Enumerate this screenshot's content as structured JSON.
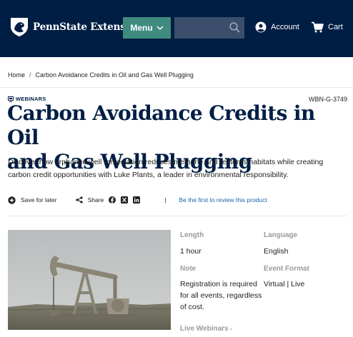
{
  "header": {
    "logo_text": "PennState Extension",
    "menu_label": "Menu",
    "search_placeholder": "",
    "account_label": "Account",
    "cart_label": "Cart"
  },
  "breadcrumb": {
    "home": "Home",
    "separator": "/",
    "current": "Carbon Avoidance Credits in Oil and Gas Well Plugging"
  },
  "product": {
    "category": "WEBINARS",
    "sku": "WBN-G-3749",
    "title_line1": "Carbon Avoidance Credits in Oil",
    "title_line2": "and Gas Well Plugging",
    "description": "Discover how orphaned well remediation reduces methane and restores habitats while creating carbon credit opportunities with Luke Plants, a leader in environmental responsibility."
  },
  "actions": {
    "save_label": "Save for later",
    "share_label": "Share",
    "pipe": "|",
    "review_label": "Be the first to review this product"
  },
  "details": {
    "length_label": "Length",
    "length_value": "1 hour",
    "language_label": "Language",
    "language_value": "English",
    "note_label": "Note",
    "note_value": "Registration is required for all events, regardless of cost.",
    "format_label": "Event Format",
    "format_value": "Virtual | Live",
    "live_label": "Live Webinars",
    "live_suffix": "•"
  },
  "colors": {
    "header_bg": "#001e44",
    "menu_bg": "#3f8b7f",
    "search_bg": "#3a4d6a",
    "title": "#001e44",
    "link": "#1a62a8"
  },
  "icons": {
    "logo": "nittany-lion-shield-icon",
    "menu_chevron": "chevron-down-icon",
    "search": "search-icon",
    "account": "user-circle-icon",
    "cart": "cart-icon",
    "category": "webinar-icon",
    "save": "plus-circle-icon",
    "share": "share-icon",
    "facebook": "facebook-icon",
    "x": "x-icon",
    "linkedin": "linkedin-icon"
  }
}
